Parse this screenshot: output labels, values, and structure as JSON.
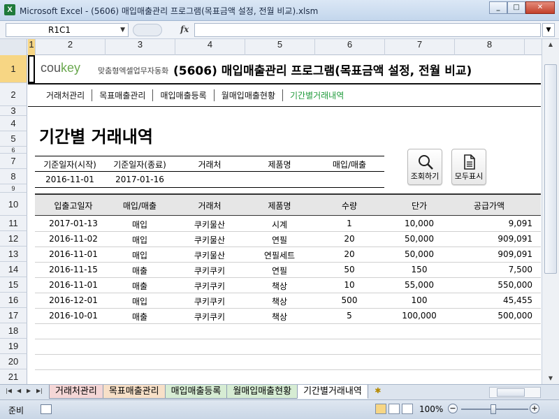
{
  "window": {
    "title": "Microsoft Excel - (5606) 매입매출관리 프로그램(목표금액 설정, 전월 비교).xlsm",
    "app_icon": "X",
    "minimize_icon": "_",
    "maximize_icon": "□",
    "close_icon": "✕"
  },
  "formula_bar": {
    "name_box": "R1C1",
    "fx": "fx",
    "formula": ""
  },
  "grid": {
    "columns": [
      "1",
      "2",
      "3",
      "4",
      "5",
      "6",
      "7",
      "8"
    ],
    "rows": [
      "1",
      "2",
      "3",
      "4",
      "5",
      "6",
      "7",
      "8",
      "9",
      "10",
      "11",
      "12",
      "13",
      "14",
      "15",
      "16",
      "17",
      "18",
      "19",
      "20",
      "21"
    ]
  },
  "sheet": {
    "logo_main": "cou",
    "logo_accent": "key",
    "logo_tagline": "맞춤형엑셀업무자동화",
    "program_title": "(5606) 매입매출관리 프로그램(목표금액 설정, 전월 비교)",
    "nav": [
      "거래처관리",
      "목표매출관리",
      "매입매출등록",
      "월매입매출현황",
      "기간별거래내역"
    ],
    "page_title": "기간별 거래내역",
    "filter": {
      "headers": [
        "기준일자(시작)",
        "기준일자(종료)",
        "거래처",
        "제품명",
        "매입/매출"
      ],
      "values": [
        "2016-11-01",
        "2017-01-16",
        "",
        "",
        ""
      ]
    },
    "buttons": {
      "search": "조회하기",
      "show_all": "모두표시"
    },
    "table": {
      "headers": [
        "입출고일자",
        "매입/매출",
        "거래처",
        "제품명",
        "수량",
        "단가",
        "공급가액"
      ],
      "rows": [
        [
          "2017-01-13",
          "매입",
          "쿠키물산",
          "시계",
          "1",
          "10,000",
          "9,091"
        ],
        [
          "2016-11-02",
          "매입",
          "쿠키물산",
          "연필",
          "20",
          "50,000",
          "909,091"
        ],
        [
          "2016-11-01",
          "매입",
          "쿠키물산",
          "연필세트",
          "20",
          "50,000",
          "909,091"
        ],
        [
          "2016-11-15",
          "매출",
          "쿠키쿠키",
          "연필",
          "50",
          "150",
          "7,500"
        ],
        [
          "2016-11-01",
          "매출",
          "쿠키쿠키",
          "책상",
          "10",
          "55,000",
          "550,000"
        ],
        [
          "2016-12-01",
          "매입",
          "쿠키쿠키",
          "책상",
          "500",
          "100",
          "45,455"
        ],
        [
          "2016-10-01",
          "매출",
          "쿠키쿠키",
          "책상",
          "5",
          "100,000",
          "500,000"
        ]
      ]
    }
  },
  "tabs": [
    "거래처관리",
    "목표매출관리",
    "매입매출등록",
    "월매입매출현황",
    "기간별거래내역"
  ],
  "status": {
    "ready": "준비",
    "zoom": "100%",
    "zoom_minus": "−",
    "zoom_plus": "+"
  }
}
